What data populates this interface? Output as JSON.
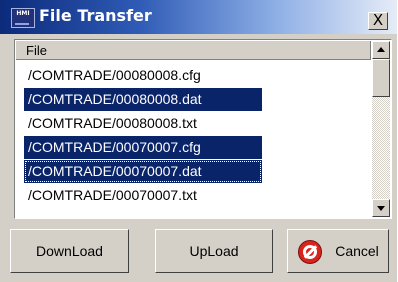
{
  "window": {
    "title": "File Transfer",
    "icon_text": "HMI",
    "close_label": "X"
  },
  "list": {
    "column_header": "File",
    "items": [
      {
        "label": "/COMTRADE/00080008.cfg",
        "selected": false
      },
      {
        "label": "/COMTRADE/00080008.dat",
        "selected": true
      },
      {
        "label": "/COMTRADE/00080008.txt",
        "selected": false
      },
      {
        "label": "/COMTRADE/00070007.cfg",
        "selected": true
      },
      {
        "label": "/COMTRADE/00070007.dat",
        "selected": true,
        "focused": true
      },
      {
        "label": "/COMTRADE/00070007.txt",
        "selected": false
      }
    ]
  },
  "buttons": {
    "download": "DownLoad",
    "upload": "UpLoad",
    "cancel": "Cancel"
  },
  "colors": {
    "selection": "#0a246a",
    "titlebar_start": "#0b2a7a",
    "cancel_icon": "#d8241c"
  }
}
